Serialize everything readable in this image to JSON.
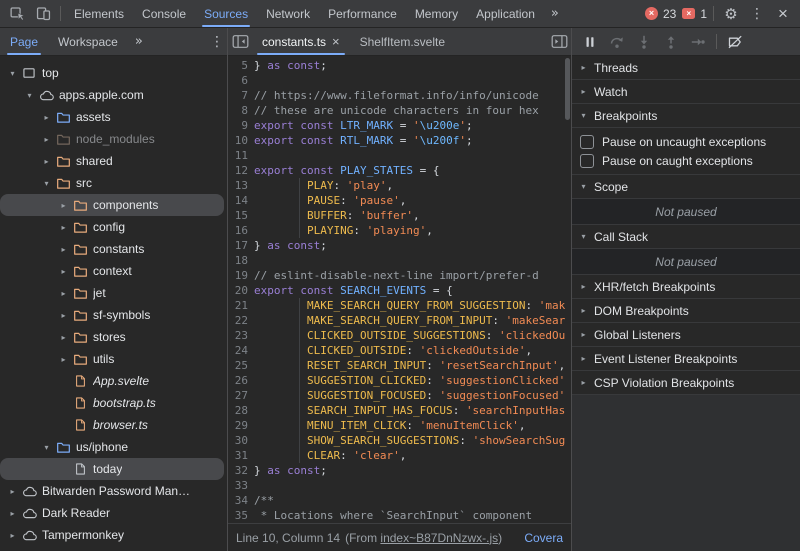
{
  "colors": {
    "accent_blue": "#7cacf8",
    "error_red": "#e46962",
    "folder_orange": "#e8ab7c",
    "folder_blue": "#7cacf8",
    "syntax_keyword": "#9a7fd5",
    "syntax_variable": "#71b1ff",
    "syntax_property": "#eebb4d",
    "syntax_string": "#f28b54",
    "syntax_comment": "#9aa0a6"
  },
  "toolbar": {
    "tabs": [
      "Elements",
      "Console",
      "Sources",
      "Network",
      "Performance",
      "Memory",
      "Application"
    ],
    "active_tab": "Sources",
    "more_tabs_label": "»",
    "error_count": "23",
    "issue_count": "1",
    "error_icon": "×",
    "issue_icon": "×",
    "gear_icon": "⚙",
    "kebab_icon": "⋮",
    "close_icon": "×"
  },
  "navigator": {
    "tabs": [
      "Page",
      "Workspace"
    ],
    "active_tab": "Page",
    "more_tabs_label": "»",
    "menu_icon": "⋮",
    "tree": [
      {
        "label": "top",
        "level": 0,
        "arrow": "down",
        "icon": "frame",
        "color": "plain"
      },
      {
        "label": "apps.apple.com",
        "level": 1,
        "arrow": "down",
        "icon": "cloud",
        "color": "plain"
      },
      {
        "label": "assets",
        "level": 2,
        "arrow": "right",
        "icon": "folder",
        "color": "blue"
      },
      {
        "label": "node_modules",
        "level": 2,
        "arrow": "right",
        "icon": "folder",
        "color": "dim",
        "dim": true
      },
      {
        "label": "shared",
        "level": 2,
        "arrow": "right",
        "icon": "folder",
        "color": "orange"
      },
      {
        "label": "src",
        "level": 2,
        "arrow": "down",
        "icon": "folder",
        "color": "orange"
      },
      {
        "label": "components",
        "level": 3,
        "arrow": "right",
        "icon": "folder",
        "color": "orange",
        "selected": true
      },
      {
        "label": "config",
        "level": 3,
        "arrow": "right",
        "icon": "folder",
        "color": "orange"
      },
      {
        "label": "constants",
        "level": 3,
        "arrow": "right",
        "icon": "folder",
        "color": "orange"
      },
      {
        "label": "context",
        "level": 3,
        "arrow": "right",
        "icon": "folder",
        "color": "orange"
      },
      {
        "label": "jet",
        "level": 3,
        "arrow": "right",
        "icon": "folder",
        "color": "orange"
      },
      {
        "label": "sf-symbols",
        "level": 3,
        "arrow": "right",
        "icon": "folder",
        "color": "orange"
      },
      {
        "label": "stores",
        "level": 3,
        "arrow": "right",
        "icon": "folder",
        "color": "orange"
      },
      {
        "label": "utils",
        "level": 3,
        "arrow": "right",
        "icon": "folder",
        "color": "orange"
      },
      {
        "label": "App.svelte",
        "level": 3,
        "icon": "file",
        "color": "orange",
        "italic": true
      },
      {
        "label": "bootstrap.ts",
        "level": 3,
        "icon": "file",
        "color": "orange",
        "italic": true
      },
      {
        "label": "browser.ts",
        "level": 3,
        "icon": "file",
        "color": "orange",
        "italic": true
      },
      {
        "label": "us/iphone",
        "level": 2,
        "arrow": "down",
        "icon": "folder",
        "color": "blue"
      },
      {
        "label": "today",
        "level": 3,
        "icon": "file",
        "color": "plain",
        "selected": true
      },
      {
        "label": "Bitwarden Password Man…",
        "level": 0,
        "arrow": "right",
        "icon": "cloud",
        "color": "plain"
      },
      {
        "label": "Dark Reader",
        "level": 0,
        "arrow": "right",
        "icon": "cloud",
        "color": "plain"
      },
      {
        "label": "Tampermonkey",
        "level": 0,
        "arrow": "right",
        "icon": "cloud",
        "color": "plain"
      }
    ]
  },
  "editor": {
    "tabs": [
      {
        "label": "constants.ts",
        "active": true,
        "closable": true
      },
      {
        "label": "ShelfItem.svelte",
        "active": false,
        "closable": false
      }
    ],
    "close_label": "×",
    "lines": [
      {
        "n": "5",
        "s": [
          [
            "pln",
            "} "
          ],
          [
            "kw",
            "as"
          ],
          [
            "pln",
            " "
          ],
          [
            "kw",
            "const"
          ],
          [
            "pln",
            ";"
          ]
        ]
      },
      {
        "n": "6",
        "s": []
      },
      {
        "n": "7",
        "s": [
          [
            "cmt",
            "// https://www.fileformat.info/info/unicode"
          ]
        ]
      },
      {
        "n": "8",
        "s": [
          [
            "cmt",
            "// these are unicode characters in four hex"
          ]
        ]
      },
      {
        "n": "9",
        "s": [
          [
            "kw",
            "export"
          ],
          [
            "pln",
            " "
          ],
          [
            "kw",
            "const"
          ],
          [
            "pln",
            " "
          ],
          [
            "def",
            "LTR_MARK"
          ],
          [
            "pln",
            " = "
          ],
          [
            "str",
            "'"
          ],
          [
            "esc",
            "\\u200e"
          ],
          [
            "str",
            "'"
          ],
          [
            "pln",
            ";"
          ]
        ]
      },
      {
        "n": "10",
        "s": [
          [
            "kw",
            "export"
          ],
          [
            "pln",
            " "
          ],
          [
            "kw",
            "const"
          ],
          [
            "pln",
            " "
          ],
          [
            "def",
            "RTL_MARK"
          ],
          [
            "pln",
            " = "
          ],
          [
            "str",
            "'"
          ],
          [
            "esc",
            "\\u200f"
          ],
          [
            "str",
            "'"
          ],
          [
            "pln",
            ";"
          ]
        ]
      },
      {
        "n": "11",
        "s": []
      },
      {
        "n": "12",
        "s": [
          [
            "kw",
            "export"
          ],
          [
            "pln",
            " "
          ],
          [
            "kw",
            "const"
          ],
          [
            "pln",
            " "
          ],
          [
            "def",
            "PLAY_STATES"
          ],
          [
            "pln",
            " = {"
          ]
        ]
      },
      {
        "n": "13",
        "s": [
          [
            "pln",
            "        "
          ],
          [
            "prop",
            "PLAY"
          ],
          [
            "pln",
            ": "
          ],
          [
            "str",
            "'play'"
          ],
          [
            "pln",
            ","
          ]
        ]
      },
      {
        "n": "14",
        "s": [
          [
            "pln",
            "        "
          ],
          [
            "prop",
            "PAUSE"
          ],
          [
            "pln",
            ": "
          ],
          [
            "str",
            "'pause'"
          ],
          [
            "pln",
            ","
          ]
        ]
      },
      {
        "n": "15",
        "s": [
          [
            "pln",
            "        "
          ],
          [
            "prop",
            "BUFFER"
          ],
          [
            "pln",
            ": "
          ],
          [
            "str",
            "'buffer'"
          ],
          [
            "pln",
            ","
          ]
        ]
      },
      {
        "n": "16",
        "s": [
          [
            "pln",
            "        "
          ],
          [
            "prop",
            "PLAYING"
          ],
          [
            "pln",
            ": "
          ],
          [
            "str",
            "'playing'"
          ],
          [
            "pln",
            ","
          ]
        ]
      },
      {
        "n": "17",
        "s": [
          [
            "pln",
            "} "
          ],
          [
            "kw",
            "as"
          ],
          [
            "pln",
            " "
          ],
          [
            "kw",
            "const"
          ],
          [
            "pln",
            ";"
          ]
        ]
      },
      {
        "n": "18",
        "s": []
      },
      {
        "n": "19",
        "s": [
          [
            "cmt",
            "// eslint-disable-next-line import/prefer-d"
          ]
        ]
      },
      {
        "n": "20",
        "s": [
          [
            "kw",
            "export"
          ],
          [
            "pln",
            " "
          ],
          [
            "kw",
            "const"
          ],
          [
            "pln",
            " "
          ],
          [
            "def",
            "SEARCH_EVENTS"
          ],
          [
            "pln",
            " = {"
          ]
        ]
      },
      {
        "n": "21",
        "s": [
          [
            "pln",
            "        "
          ],
          [
            "prop",
            "MAKE_SEARCH_QUERY_FROM_SUGGESTION"
          ],
          [
            "pln",
            ": "
          ],
          [
            "str",
            "'mak"
          ]
        ]
      },
      {
        "n": "22",
        "s": [
          [
            "pln",
            "        "
          ],
          [
            "prop",
            "MAKE_SEARCH_QUERY_FROM_INPUT"
          ],
          [
            "pln",
            ": "
          ],
          [
            "str",
            "'makeSear"
          ]
        ]
      },
      {
        "n": "23",
        "s": [
          [
            "pln",
            "        "
          ],
          [
            "prop",
            "CLICKED_OUTSIDE_SUGGESTIONS"
          ],
          [
            "pln",
            ": "
          ],
          [
            "str",
            "'clickedOu"
          ]
        ]
      },
      {
        "n": "24",
        "s": [
          [
            "pln",
            "        "
          ],
          [
            "prop",
            "CLICKED_OUTSIDE"
          ],
          [
            "pln",
            ": "
          ],
          [
            "str",
            "'clickedOutside'"
          ],
          [
            "pln",
            ","
          ]
        ]
      },
      {
        "n": "25",
        "s": [
          [
            "pln",
            "        "
          ],
          [
            "prop",
            "RESET_SEARCH_INPUT"
          ],
          [
            "pln",
            ": "
          ],
          [
            "str",
            "'resetSearchInput'"
          ],
          [
            "pln",
            ","
          ]
        ]
      },
      {
        "n": "26",
        "s": [
          [
            "pln",
            "        "
          ],
          [
            "prop",
            "SUGGESTION_CLICKED"
          ],
          [
            "pln",
            ": "
          ],
          [
            "str",
            "'suggestionClicked'"
          ]
        ]
      },
      {
        "n": "27",
        "s": [
          [
            "pln",
            "        "
          ],
          [
            "prop",
            "SUGGESTION_FOCUSED"
          ],
          [
            "pln",
            ": "
          ],
          [
            "str",
            "'suggestionFocused'"
          ]
        ]
      },
      {
        "n": "28",
        "s": [
          [
            "pln",
            "        "
          ],
          [
            "prop",
            "SEARCH_INPUT_HAS_FOCUS"
          ],
          [
            "pln",
            ": "
          ],
          [
            "str",
            "'searchInputHas"
          ]
        ]
      },
      {
        "n": "29",
        "s": [
          [
            "pln",
            "        "
          ],
          [
            "prop",
            "MENU_ITEM_CLICK"
          ],
          [
            "pln",
            ": "
          ],
          [
            "str",
            "'menuItemClick'"
          ],
          [
            "pln",
            ","
          ]
        ]
      },
      {
        "n": "30",
        "s": [
          [
            "pln",
            "        "
          ],
          [
            "prop",
            "SHOW_SEARCH_SUGGESTIONS"
          ],
          [
            "pln",
            ": "
          ],
          [
            "str",
            "'showSearchSug"
          ]
        ]
      },
      {
        "n": "31",
        "s": [
          [
            "pln",
            "        "
          ],
          [
            "prop",
            "CLEAR"
          ],
          [
            "pln",
            ": "
          ],
          [
            "str",
            "'clear'"
          ],
          [
            "pln",
            ","
          ]
        ]
      },
      {
        "n": "32",
        "s": [
          [
            "pln",
            "} "
          ],
          [
            "kw",
            "as"
          ],
          [
            "pln",
            " "
          ],
          [
            "kw",
            "const"
          ],
          [
            "pln",
            ";"
          ]
        ]
      },
      {
        "n": "33",
        "s": []
      },
      {
        "n": "34",
        "s": [
          [
            "cmt",
            "/**"
          ]
        ]
      },
      {
        "n": "35",
        "s": [
          [
            "cmt",
            " * Locations where `SearchInput` component"
          ]
        ]
      }
    ],
    "status": {
      "position": "Line 10, Column 14",
      "from_prefix": "(From ",
      "from_file": "index~B87DnNzwx-.js",
      "from_suffix": ")",
      "coverage": "Covera"
    }
  },
  "debugger": {
    "toolbar_icons": [
      {
        "name": "pause-button",
        "disabled": false
      },
      {
        "name": "step-over-button",
        "disabled": true
      },
      {
        "name": "step-into-button",
        "disabled": true
      },
      {
        "name": "step-out-button",
        "disabled": true
      },
      {
        "name": "step-button",
        "disabled": true
      },
      {
        "name": "divider"
      },
      {
        "name": "deactivate-breakpoints-button",
        "disabled": false
      }
    ],
    "sections": [
      {
        "label": "Threads",
        "expanded": false
      },
      {
        "label": "Watch",
        "expanded": false
      },
      {
        "label": "Breakpoints",
        "expanded": true,
        "checkboxes": [
          {
            "label": "Pause on uncaught exceptions",
            "checked": false
          },
          {
            "label": "Pause on caught exceptions",
            "checked": false
          }
        ]
      },
      {
        "label": "Scope",
        "expanded": true,
        "placeholder": "Not paused"
      },
      {
        "label": "Call Stack",
        "expanded": true,
        "placeholder": "Not paused"
      },
      {
        "label": "XHR/fetch Breakpoints",
        "expanded": false
      },
      {
        "label": "DOM Breakpoints",
        "expanded": false
      },
      {
        "label": "Global Listeners",
        "expanded": false
      },
      {
        "label": "Event Listener Breakpoints",
        "expanded": false
      },
      {
        "label": "CSP Violation Breakpoints",
        "expanded": false
      }
    ]
  }
}
